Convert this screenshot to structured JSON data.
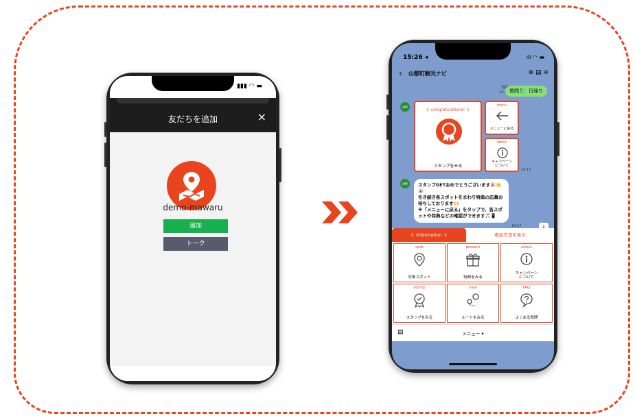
{
  "left_phone": {
    "status": "▮▮▮ ◠ ▬",
    "header_title": "友だちを追加",
    "close_icon": "×",
    "account_name": "demo-mawaru",
    "add_button": "追加",
    "talk_button": "トーク"
  },
  "arrow_glyph": "»",
  "right_phone": {
    "time": "15:26 ◂",
    "status": "ıll ◠ ▬",
    "back": "‹",
    "title": "山都町観光ナビ",
    "nav_icons": "⊕ ▤ ≡",
    "read_tag": "既読\n14:17",
    "user_message": "質問５：日帰り",
    "avatar_label": "山都町",
    "card_big_title": "〻 congratulations! 〻",
    "card_big_label": "スタンプをみる",
    "menu_card_title": "menu",
    "menu_card_label": "メニューに戻る",
    "about_card_title": "about",
    "about_card_label": "キャンペーン\nについて",
    "time1": "14:17",
    "bot_message": "スタンプGETおめでとうございます🎉👏🎉\n引き続き各スポットをまわり特典の応募お待ちしております🙌\n※「メニューに戻る」をタップで、各スポットや特典などの確認ができます🎵📱",
    "time2": "14:17",
    "down_icon": "↓",
    "tab_info": "〻 information 〻",
    "tab_join": "参加方法を見る",
    "grid": [
      {
        "en": "spot",
        "jp": "対象スポット"
      },
      {
        "en": "present",
        "jp": "特典をみる"
      },
      {
        "en": "about",
        "jp": "キャンペーン\nについて"
      },
      {
        "en": "stomp",
        "jp": "スタンプをみる"
      },
      {
        "en": "navi",
        "jp": "ルートをみる"
      },
      {
        "en": "FAQ",
        "jp": "よくある質問"
      }
    ],
    "keyboard_icon": "▤",
    "menu_label": "メニュー ▾"
  },
  "colors": {
    "accent": "#e8441e",
    "line_green": "#16b04e",
    "chat_bg": "#7e9ccd"
  }
}
